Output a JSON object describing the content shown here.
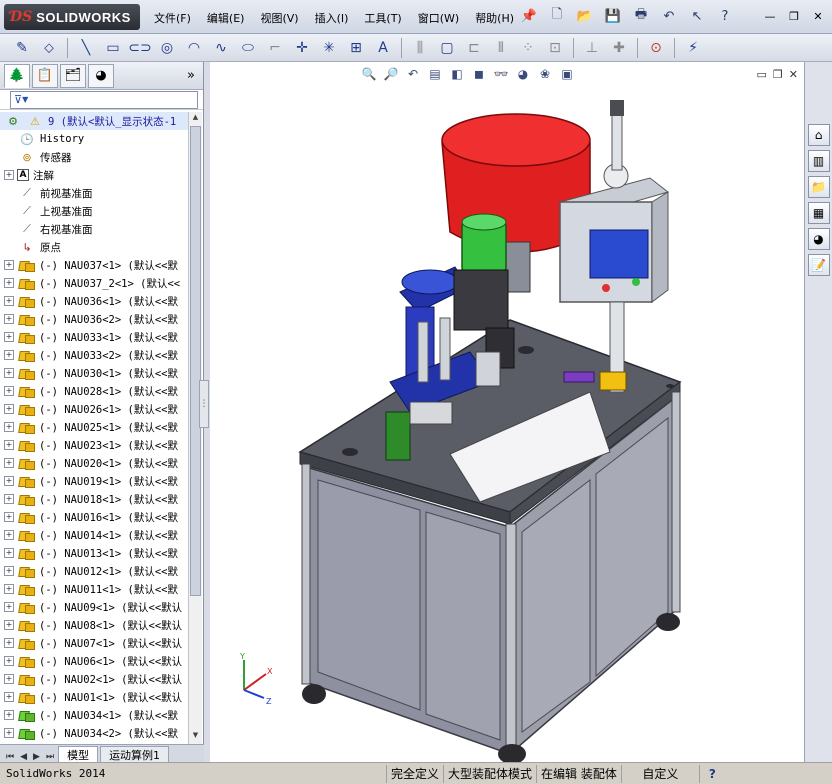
{
  "app": {
    "logo_ds": "ƊS",
    "logo_name": "SOLIDWORKS"
  },
  "menu": [
    {
      "label": "文件(F)"
    },
    {
      "label": "编辑(E)"
    },
    {
      "label": "视图(V)"
    },
    {
      "label": "插入(I)"
    },
    {
      "label": "工具(T)"
    },
    {
      "label": "窗口(W)"
    },
    {
      "label": "帮助(H)"
    }
  ],
  "filter": {
    "symbol": "▼"
  },
  "tree": {
    "root_label": "9  (默认<默认_显示状态-1",
    "fixed_items": [
      {
        "label": "History",
        "icon": "history-icon"
      },
      {
        "label": "传感器",
        "icon": "sensor-icon"
      },
      {
        "label": "注解",
        "icon": "annotation-icon"
      },
      {
        "label": "前视基准面",
        "icon": "plane-icon"
      },
      {
        "label": "上视基准面",
        "icon": "plane-icon"
      },
      {
        "label": "右视基准面",
        "icon": "plane-icon"
      },
      {
        "label": "原点",
        "icon": "origin-icon"
      }
    ],
    "components": [
      {
        "label": "(-) NAU037<1> (默认<<默",
        "green": false
      },
      {
        "label": "(-) NAU037_2<1> (默认<<",
        "green": false
      },
      {
        "label": "(-) NAU036<1> (默认<<默",
        "green": false
      },
      {
        "label": "(-) NAU036<2> (默认<<默",
        "green": false
      },
      {
        "label": "(-) NAU033<1> (默认<<默",
        "green": false
      },
      {
        "label": "(-) NAU033<2> (默认<<默",
        "green": false
      },
      {
        "label": "(-) NAU030<1> (默认<<默",
        "green": false
      },
      {
        "label": "(-) NAU028<1> (默认<<默",
        "green": false
      },
      {
        "label": "(-) NAU026<1> (默认<<默",
        "green": false
      },
      {
        "label": "(-) NAU025<1> (默认<<默",
        "green": false
      },
      {
        "label": "(-) NAU023<1> (默认<<默",
        "green": false
      },
      {
        "label": "(-) NAU020<1> (默认<<默",
        "green": false
      },
      {
        "label": "(-) NAU019<1> (默认<<默",
        "green": false
      },
      {
        "label": "(-) NAU018<1> (默认<<默",
        "green": false
      },
      {
        "label": "(-) NAU016<1> (默认<<默",
        "green": false
      },
      {
        "label": "(-) NAU014<1> (默认<<默",
        "green": false
      },
      {
        "label": "(-) NAU013<1> (默认<<默",
        "green": false
      },
      {
        "label": "(-) NAU012<1> (默认<<默",
        "green": false
      },
      {
        "label": "(-) NAU011<1> (默认<<默",
        "green": false
      },
      {
        "label": "(-) NAU09<1> (默认<<默认",
        "green": false
      },
      {
        "label": "(-) NAU08<1> (默认<<默认",
        "green": false
      },
      {
        "label": "(-) NAU07<1> (默认<<默认",
        "green": false
      },
      {
        "label": "(-) NAU06<1> (默认<<默认",
        "green": false
      },
      {
        "label": "(-) NAU02<1> (默认<<默认",
        "green": false
      },
      {
        "label": "(-) NAU01<1> (默认<<默认",
        "green": false
      },
      {
        "label": "(-) NAU034<1> (默认<<默",
        "green": true
      },
      {
        "label": "(-) NAU034<2> (默认<<默",
        "green": true
      }
    ]
  },
  "bottom_tabs": [
    {
      "label": "模型"
    },
    {
      "label": "运动算例1"
    }
  ],
  "statusbar": {
    "app": "SolidWorks 2014",
    "cells": [
      "完全定义",
      "大型装配体模式",
      "在编辑 装配体"
    ],
    "custom": "自定义",
    "help": "?"
  },
  "triad": {
    "x": "X",
    "y": "Y",
    "z": "Z"
  },
  "colors": {
    "bowl_red": "#e02020",
    "motor_green": "#35c040",
    "frame_blue": "#2233aa",
    "cabinet_grey": "#9a9aa6",
    "screen_blue": "#2a4ad0"
  }
}
